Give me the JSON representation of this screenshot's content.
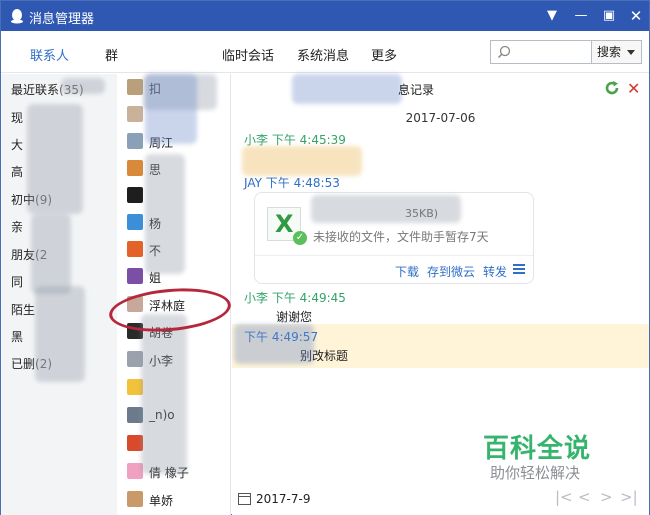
{
  "window": {
    "title": "消息管理器"
  },
  "tabs": [
    {
      "label": "联系人",
      "active": true
    },
    {
      "label": "群",
      "active": false
    },
    {
      "label": "临时会话",
      "active": false
    },
    {
      "label": "系统消息",
      "active": false
    },
    {
      "label": "更多",
      "active": false
    }
  ],
  "search": {
    "value": "",
    "button_label": "搜索"
  },
  "categories": [
    {
      "label": "最近联系",
      "count": "(35)"
    },
    {
      "label": "现",
      "count": ""
    },
    {
      "label": "大",
      "count": ""
    },
    {
      "label": "高",
      "count": ""
    },
    {
      "label": "初中",
      "count": "(9)"
    },
    {
      "label": "亲",
      "count": ""
    },
    {
      "label": "朋友",
      "count": "(2"
    },
    {
      "label": "同",
      "count": ""
    },
    {
      "label": "陌生",
      "count": ""
    },
    {
      "label": "黑",
      "count": ""
    },
    {
      "label": "已删",
      "count": "(2)"
    }
  ],
  "contacts": [
    {
      "name": "扣"
    },
    {
      "name": ""
    },
    {
      "name": "周江"
    },
    {
      "name": "思"
    },
    {
      "name": ""
    },
    {
      "name": "杨"
    },
    {
      "name": "不"
    },
    {
      "name": "姐"
    },
    {
      "name": "浮林庭"
    },
    {
      "name": "胡卷"
    },
    {
      "name": "小李"
    },
    {
      "name": ""
    },
    {
      "name": "_n)o"
    },
    {
      "name": ""
    },
    {
      "name": "倩 橡子"
    },
    {
      "name": "单娇"
    }
  ],
  "chat": {
    "title": "息记录",
    "date_separator": "2017-07-06",
    "messages": [
      {
        "sender": "小李",
        "time": "下午 4:45:39",
        "text": ""
      },
      {
        "sender": "JAY",
        "time": "下午 4:48:53",
        "text": ""
      },
      {
        "sender": "小李",
        "time": "下午 4:49:45",
        "text": "谢谢您"
      },
      {
        "sender": "",
        "time": "下午 4:49:57",
        "text": "别改标题"
      }
    ],
    "file": {
      "size": "35KB)",
      "status": "未接收的文件，文件助手暂存7天",
      "actions": [
        "下载",
        "存到微云",
        "转发"
      ]
    },
    "footer_date": "2017-7-9",
    "pager": [
      "|<",
      "<",
      ">",
      ">|"
    ]
  },
  "watermark": {
    "main": "百科全说",
    "sub": "助你轻松解决"
  },
  "colors": {
    "titlebar": "#2f58b3",
    "accent": "#2f6fc6",
    "sender_green": "#34a36a",
    "highlight": "#fff4d8"
  }
}
